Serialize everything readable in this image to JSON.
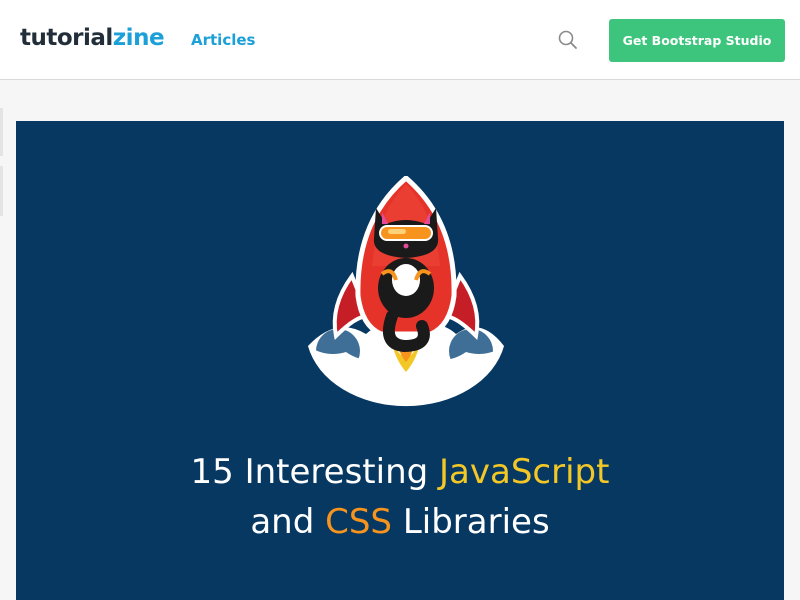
{
  "header": {
    "logo": {
      "part1": "tutorial",
      "part2": "zine"
    },
    "nav": {
      "articles_label": "Articles"
    },
    "search": {
      "icon": "search-icon"
    },
    "cta": {
      "label": "Get Bootstrap Studio"
    }
  },
  "hero": {
    "title": {
      "line1_prefix": "15 Interesting ",
      "line1_highlight": "JavaScript",
      "line2_prefix": "and ",
      "line2_highlight": "CSS",
      "line2_suffix": " Libraries"
    },
    "illustration": {
      "icon": "rocket-cat-illustration"
    }
  },
  "colors": {
    "brand_dark": "#222f3a",
    "brand_blue": "#1ba0d8",
    "cta_green": "#3ec57d",
    "hero_bg": "#073862",
    "highlight_yellow": "#f3c826",
    "highlight_orange": "#f7941d"
  }
}
